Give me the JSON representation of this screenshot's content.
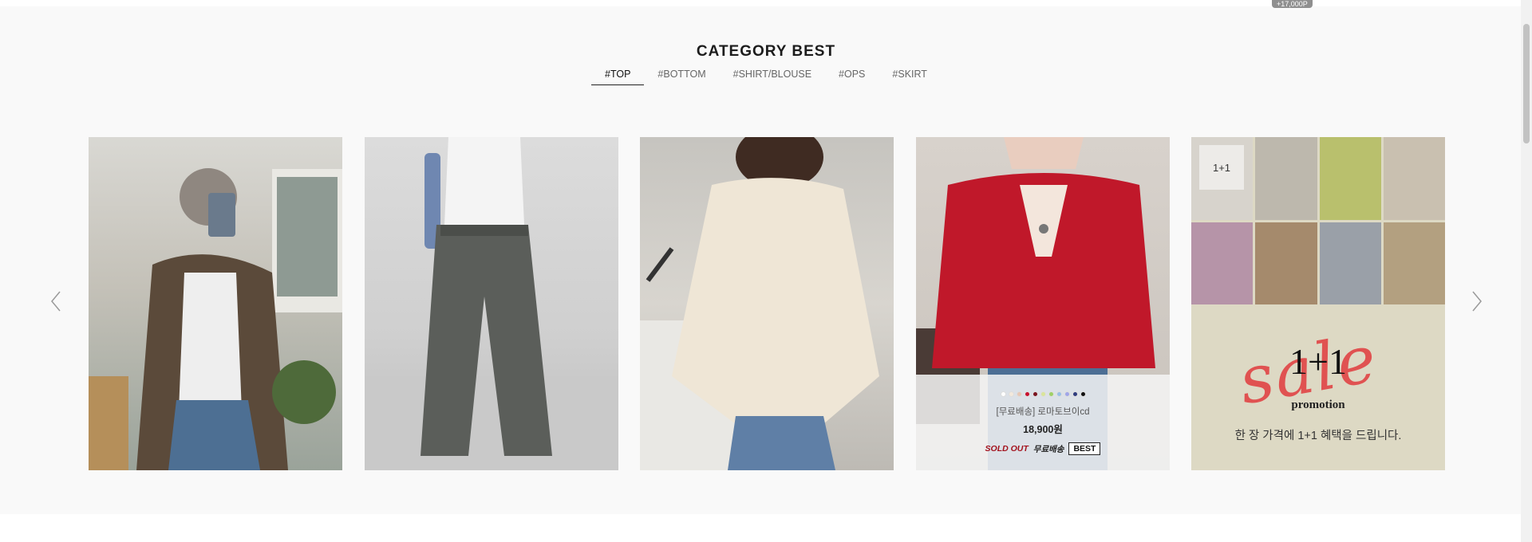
{
  "top_price_badge": "+17,000P",
  "section": {
    "title": "CATEGORY BEST",
    "tabs": [
      {
        "label": "#TOP",
        "active": true
      },
      {
        "label": "#BOTTOM",
        "active": false
      },
      {
        "label": "#SHIRT/BLOUSE",
        "active": false
      },
      {
        "label": "#OPS",
        "active": false
      },
      {
        "label": "#SKIRT",
        "active": false
      }
    ]
  },
  "nav": {
    "prev_icon": "chevron-left-icon",
    "next_icon": "chevron-right-icon"
  },
  "products": [
    {
      "image": "plaid-shirt-photo"
    },
    {
      "image": "wide-pants-photo"
    },
    {
      "image": "cable-knit-photo"
    },
    {
      "image": "red-cardigan-photo",
      "swatch_colors": [
        "#ffffff",
        "#f3e9dc",
        "#e7c7b5",
        "#c8102e",
        "#7a1420",
        "#d9e59a",
        "#9fd066",
        "#9ac0e6",
        "#a0a6e8",
        "#2f3c7e",
        "#111111"
      ],
      "name": "[무료배송] 로마토브이cd",
      "price": "18,900원",
      "badges": {
        "sold_out": "SOLD OUT",
        "free_shipping": "무료배송",
        "best": "BEST"
      }
    }
  ],
  "promotion": {
    "thumb_label": "1+1",
    "sale_script": "sale",
    "headline": "1+1",
    "subtitle": "promotion",
    "description": "한 장 가격에 1+1 혜택을 드립니다."
  }
}
